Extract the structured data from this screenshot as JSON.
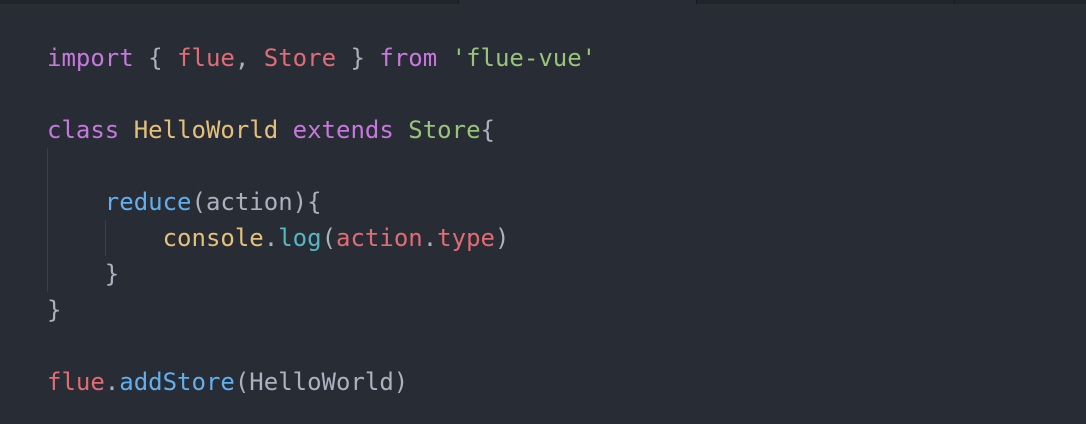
{
  "editor": {
    "lines": [
      {
        "tokens": [
          {
            "text": "import",
            "kind": "keyword"
          },
          {
            "text": " { ",
            "kind": "plain"
          },
          {
            "text": "flue",
            "kind": "variable"
          },
          {
            "text": ", ",
            "kind": "plain"
          },
          {
            "text": "Store",
            "kind": "variable"
          },
          {
            "text": " } ",
            "kind": "plain"
          },
          {
            "text": "from",
            "kind": "keyword"
          },
          {
            "text": " ",
            "kind": "plain"
          },
          {
            "text": "'flue-vue'",
            "kind": "string"
          }
        ]
      },
      {
        "tokens": []
      },
      {
        "tokens": [
          {
            "text": "class",
            "kind": "keyword"
          },
          {
            "text": " ",
            "kind": "plain"
          },
          {
            "text": "HelloWorld",
            "kind": "class"
          },
          {
            "text": " ",
            "kind": "plain"
          },
          {
            "text": "extends",
            "kind": "keyword"
          },
          {
            "text": " ",
            "kind": "plain"
          },
          {
            "text": "Store",
            "kind": "string"
          },
          {
            "text": "{",
            "kind": "plain"
          }
        ]
      },
      {
        "tokens": []
      },
      {
        "tokens": [
          {
            "text": "    ",
            "kind": "plain"
          },
          {
            "text": "reduce",
            "kind": "function"
          },
          {
            "text": "(action){",
            "kind": "plain"
          }
        ]
      },
      {
        "tokens": [
          {
            "text": "        ",
            "kind": "plain"
          },
          {
            "text": "console",
            "kind": "class"
          },
          {
            "text": ".",
            "kind": "plain"
          },
          {
            "text": "log",
            "kind": "method"
          },
          {
            "text": "(",
            "kind": "plain"
          },
          {
            "text": "action",
            "kind": "variable"
          },
          {
            "text": ".",
            "kind": "plain"
          },
          {
            "text": "type",
            "kind": "variable"
          },
          {
            "text": ")",
            "kind": "plain"
          }
        ]
      },
      {
        "tokens": [
          {
            "text": "    }",
            "kind": "plain"
          }
        ]
      },
      {
        "tokens": [
          {
            "text": "}",
            "kind": "plain"
          }
        ]
      },
      {
        "tokens": []
      },
      {
        "tokens": [
          {
            "text": "flue",
            "kind": "variable"
          },
          {
            "text": ".",
            "kind": "plain"
          },
          {
            "text": "addStore",
            "kind": "function"
          },
          {
            "text": "(HelloWorld)",
            "kind": "plain"
          }
        ]
      }
    ]
  },
  "colors": {
    "background": "#282c34",
    "keyword": "#c678dd",
    "variable": "#e06c75",
    "string": "#98c379",
    "class": "#e5c07b",
    "function": "#61afef",
    "method": "#56b6c2",
    "plain": "#abb2bf"
  }
}
